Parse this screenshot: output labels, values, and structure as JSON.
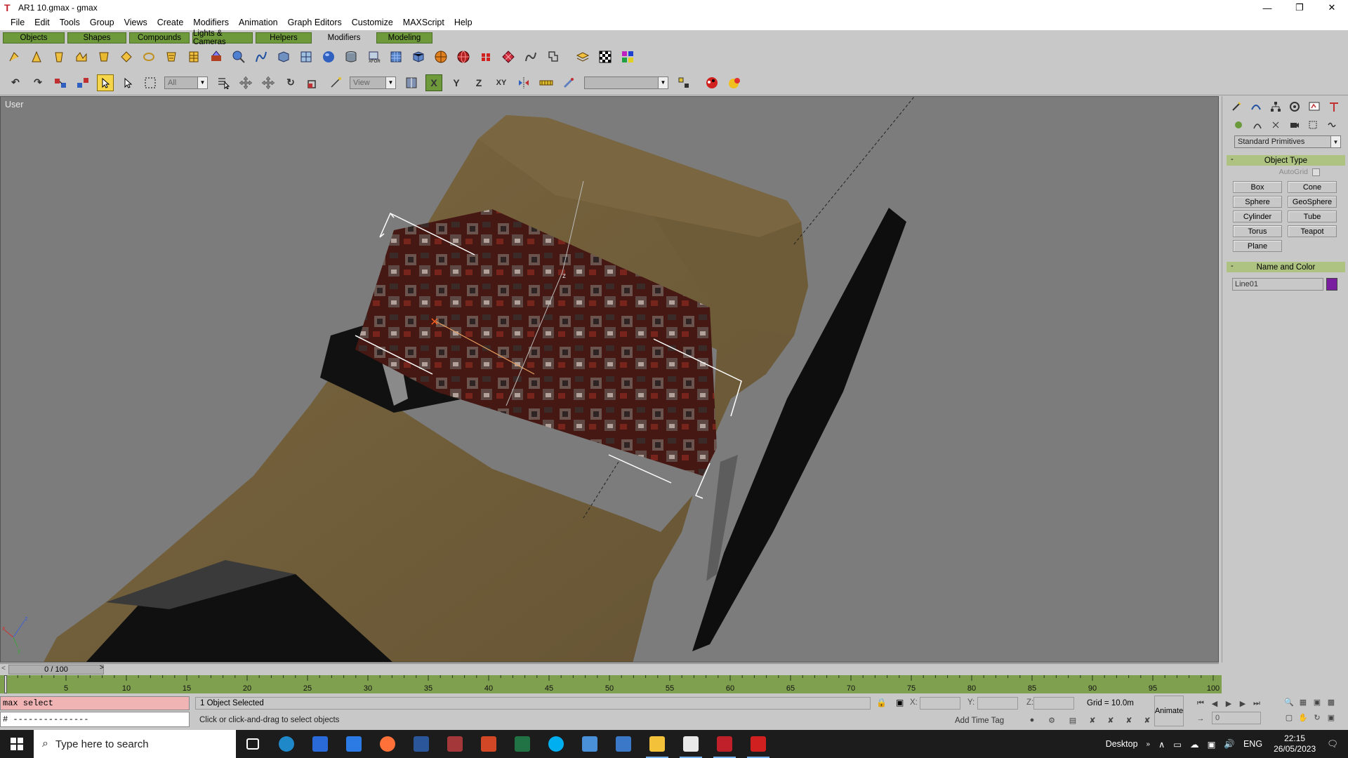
{
  "window": {
    "title": "AR1 10.gmax - gmax",
    "controls": [
      "minimize",
      "maximize",
      "close"
    ]
  },
  "menu": [
    "File",
    "Edit",
    "Tools",
    "Group",
    "Views",
    "Create",
    "Modifiers",
    "Animation",
    "Graph Editors",
    "Customize",
    "MAXScript",
    "Help"
  ],
  "tabs": [
    {
      "label": "Objects",
      "active": false
    },
    {
      "label": "Shapes",
      "active": false
    },
    {
      "label": "Compounds",
      "active": false
    },
    {
      "label": "Lights & Cameras",
      "active": false
    },
    {
      "label": "Helpers",
      "active": false
    },
    {
      "label": "Modifiers",
      "active": true
    },
    {
      "label": "Modeling",
      "active": false
    }
  ],
  "toolbar2": {
    "selection_filter": "All",
    "reference_coord": "View",
    "named_selection": ""
  },
  "viewport": {
    "label": "User",
    "background": "#7c7c7c"
  },
  "command_panel": {
    "category": "Standard Primitives",
    "object_type": {
      "header": "Object Type",
      "autogrid_label": "AutoGrid",
      "buttons": [
        "Box",
        "Cone",
        "Sphere",
        "GeoSphere",
        "Cylinder",
        "Tube",
        "Torus",
        "Teapot",
        "Plane"
      ]
    },
    "name_and_color": {
      "header": "Name and Color",
      "name": "Line01",
      "color": "#7a1ea0"
    }
  },
  "time_slider": {
    "position": "0 / 100",
    "current_frame": 0,
    "total_frames": 100
  },
  "trackbar": {
    "ticks": [
      "5",
      "10",
      "15",
      "20",
      "25",
      "30",
      "35",
      "40",
      "45",
      "50",
      "55",
      "60",
      "65",
      "70",
      "75",
      "80",
      "85",
      "90",
      "95",
      "100"
    ]
  },
  "status": {
    "script_input": "max select",
    "script_output": "# ---------------",
    "selection": "1 Object Selected",
    "prompt": "Click or click-and-drag to select objects",
    "x_label": "X:",
    "y_label": "Y:",
    "z_label": "Z:",
    "grid": "Grid = 10.0m",
    "time_tag": "Add Time Tag",
    "animate": "Animate",
    "frame": "0"
  },
  "taskbar": {
    "search_placeholder": "Type here to search",
    "desktop_label": "Desktop",
    "language": "ENG",
    "time": "22:15",
    "date": "26/05/2023",
    "apps": [
      {
        "name": "task-view",
        "color": "#1c1c1c"
      },
      {
        "name": "edge",
        "color": "#1e88c8"
      },
      {
        "name": "store",
        "color": "#2a6ad8"
      },
      {
        "name": "mail",
        "color": "#2c7be5"
      },
      {
        "name": "firefox",
        "color": "#ff7139"
      },
      {
        "name": "word",
        "color": "#2b579a"
      },
      {
        "name": "access",
        "color": "#a4373a"
      },
      {
        "name": "powerpoint",
        "color": "#d24726"
      },
      {
        "name": "excel",
        "color": "#217346"
      },
      {
        "name": "skype",
        "color": "#00aff0"
      },
      {
        "name": "network-app",
        "color": "#4a90d9"
      },
      {
        "name": "control-panel",
        "color": "#3b78c8"
      },
      {
        "name": "file-explorer",
        "color": "#f3c13a"
      },
      {
        "name": "window-app",
        "color": "#e8e8e8"
      },
      {
        "name": "gmax",
        "color": "#c0202a"
      },
      {
        "name": "game-app",
        "color": "#d02020"
      }
    ]
  }
}
